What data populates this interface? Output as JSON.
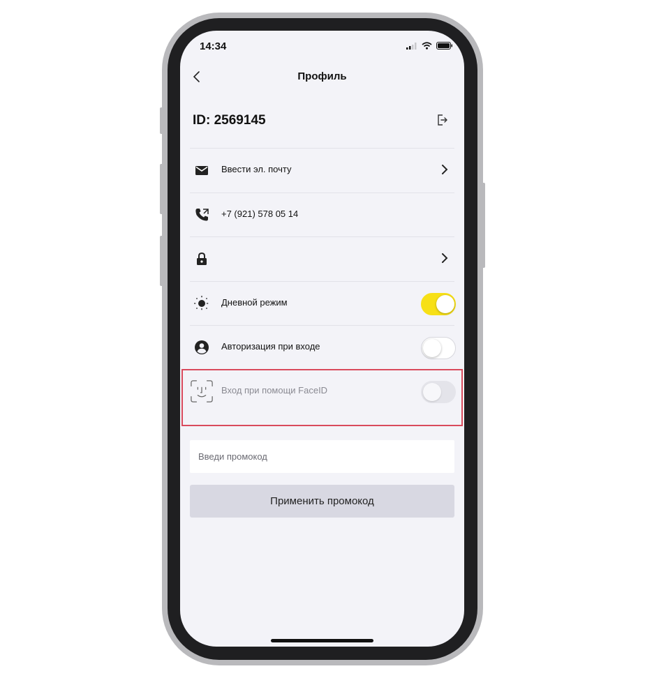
{
  "status_bar": {
    "time": "14:34"
  },
  "nav": {
    "title": "Профиль"
  },
  "profile": {
    "id_text": "ID: 2569145"
  },
  "rows": {
    "email": {
      "label": "Ввести эл. почту"
    },
    "phone": {
      "label": "+7 (921) 578 05 14"
    },
    "password": {
      "label": ""
    },
    "day_mode": {
      "label": "Дневной режим",
      "enabled": true
    },
    "auth_on_login": {
      "label": "Авторизация при входе",
      "enabled": false
    },
    "faceid": {
      "label": "Вход при помощи FaceID",
      "enabled": false,
      "disabled": true
    }
  },
  "promo": {
    "placeholder": "Введи промокод",
    "apply_label": "Применить промокод"
  },
  "colors": {
    "toggle_on": "#f7e017",
    "highlight_border": "#d94a5c",
    "screen_bg": "#f3f3f8"
  },
  "icons": [
    "back-chevron-icon",
    "logout-icon",
    "mail-icon",
    "phone-call-icon",
    "lock-icon",
    "sun-icon",
    "user-circle-icon",
    "faceid-icon",
    "chevron-right-icon"
  ]
}
